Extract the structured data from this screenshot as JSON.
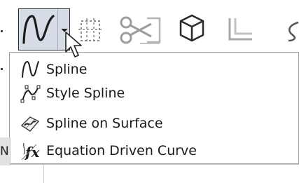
{
  "toolbar": {
    "buttons": [
      {
        "name": "spline-flyout-button",
        "icon": "spline-icon",
        "state": "pressed"
      },
      {
        "name": "sketch-picture-button",
        "icon": "dashed-box-icon"
      },
      {
        "name": "trim-entities-button",
        "icon": "scissors-icon"
      },
      {
        "name": "3d-box-button",
        "icon": "cube-icon"
      },
      {
        "name": "offset-entities-button",
        "icon": "offset-icon"
      }
    ]
  },
  "menu": {
    "items": [
      {
        "label": "Spline",
        "icon": "spline-icon"
      },
      {
        "label": "Style Spline",
        "icon": "style-spline-icon"
      },
      {
        "label": "Spline on Surface",
        "icon": "spline-on-surface-icon"
      },
      {
        "label": "Equation Driven Curve",
        "icon": "equation-curve-icon"
      }
    ]
  },
  "left_panel": {
    "letter": "N"
  },
  "colors": {
    "pressed_bg": "#d7dde6",
    "text": "#1a1a1a",
    "border": "#9b9b9b"
  }
}
